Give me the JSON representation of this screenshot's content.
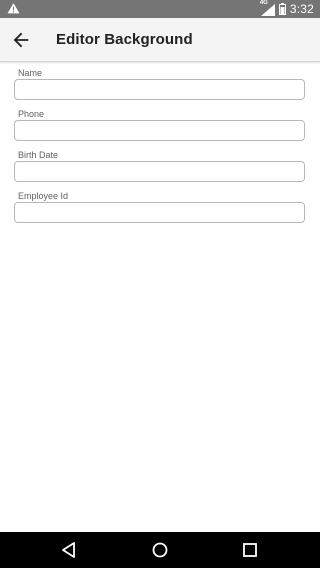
{
  "status_bar": {
    "time": "3:32",
    "network": "4G",
    "icons": [
      "warning-icon",
      "signal-icon",
      "battery-icon"
    ]
  },
  "app_bar": {
    "title": "Editor Background",
    "back_icon": "arrow-left-icon"
  },
  "form": {
    "fields": [
      {
        "label": "Name",
        "value": "",
        "placeholder": ""
      },
      {
        "label": "Phone",
        "value": "",
        "placeholder": ""
      },
      {
        "label": "Birth Date",
        "value": "",
        "placeholder": ""
      },
      {
        "label": "Employee Id",
        "value": "",
        "placeholder": ""
      }
    ]
  },
  "nav_bar": {
    "icons": [
      "back-triangle-icon",
      "home-circle-icon",
      "recents-square-icon"
    ]
  },
  "colors": {
    "status_bar": "#757575",
    "app_bar": "#f4f4f4",
    "nav_bar": "#000000",
    "input_border": "#b8b8b8"
  }
}
